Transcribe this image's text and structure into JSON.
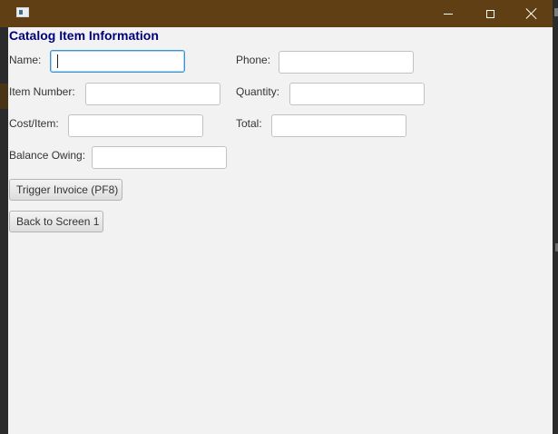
{
  "window": {
    "title": "",
    "title_bar_color": "#603f14",
    "controls": [
      "minimize-icon",
      "maximize-icon",
      "close-icon"
    ]
  },
  "form": {
    "heading": "Catalog Item Information",
    "heading_color": "#00007a",
    "fields": {
      "name": {
        "label": "Name:",
        "value": ""
      },
      "phone": {
        "label": "Phone:",
        "value": ""
      },
      "item_number": {
        "label": "Item Number:",
        "value": ""
      },
      "quantity": {
        "label": "Quantity:",
        "value": ""
      },
      "cost_item": {
        "label": "Cost/Item:",
        "value": ""
      },
      "total": {
        "label": "Total:",
        "value": ""
      },
      "balance_owing": {
        "label": "Balance Owing:",
        "value": ""
      }
    },
    "focused_field": "name",
    "focus_color": "#3a95cf"
  },
  "buttons": {
    "trigger_invoice": "Trigger Invoice (PF8)",
    "back": "Back to Screen 1"
  }
}
